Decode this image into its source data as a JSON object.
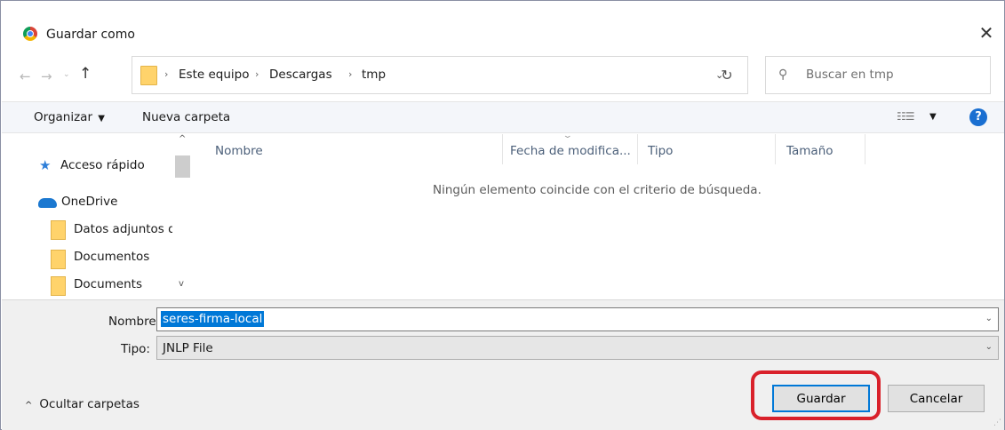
{
  "window": {
    "title": "Guardar como",
    "close_glyph": "✕"
  },
  "nav": {
    "back_glyph": "←",
    "forward_glyph": "→",
    "recent_glyph": "⌄",
    "up_glyph": "↑"
  },
  "address": {
    "sep_glyph": "›",
    "crumbs": [
      "Este equipo",
      "Descargas",
      "tmp"
    ],
    "dropdown_glyph": "⌄",
    "refresh_glyph": "↻"
  },
  "search": {
    "placeholder": "Buscar en tmp",
    "icon_glyph": "⚲"
  },
  "toolbar": {
    "organize_label": "Organizar",
    "organize_caret": "▼",
    "new_folder_label": "Nueva carpeta",
    "view_glyph": "☷☰",
    "view_caret": "▼",
    "help_glyph": "?"
  },
  "navpane": {
    "items": [
      "Acceso rápido",
      "OneDrive",
      "Datos adjuntos d",
      "Documentos",
      "Documents"
    ],
    "star_glyph": "★",
    "scroll_up_glyph": "^",
    "scroll_down_glyph": "v"
  },
  "filelist": {
    "columns": [
      "Nombre",
      "Fecha de modifica...",
      "Tipo",
      "Tamaño"
    ],
    "sort_glyph": "⌄",
    "empty_message": "Ningún elemento coincide con el criterio de búsqueda."
  },
  "form": {
    "name_label": "Nombre:",
    "name_value": "seres-firma-local",
    "type_label": "Tipo:",
    "type_value": "JNLP File",
    "dropdown_glyph": "⌄"
  },
  "footer": {
    "hide_caret": "^",
    "hide_folders_label": "Ocultar carpetas",
    "save_label": "Guardar",
    "cancel_label": "Cancelar",
    "grip_glyph": "⋰"
  },
  "colors": {
    "accent": "#0078d7",
    "highlight_annotation": "#d9212b",
    "help_blue": "#1a6fd1"
  }
}
